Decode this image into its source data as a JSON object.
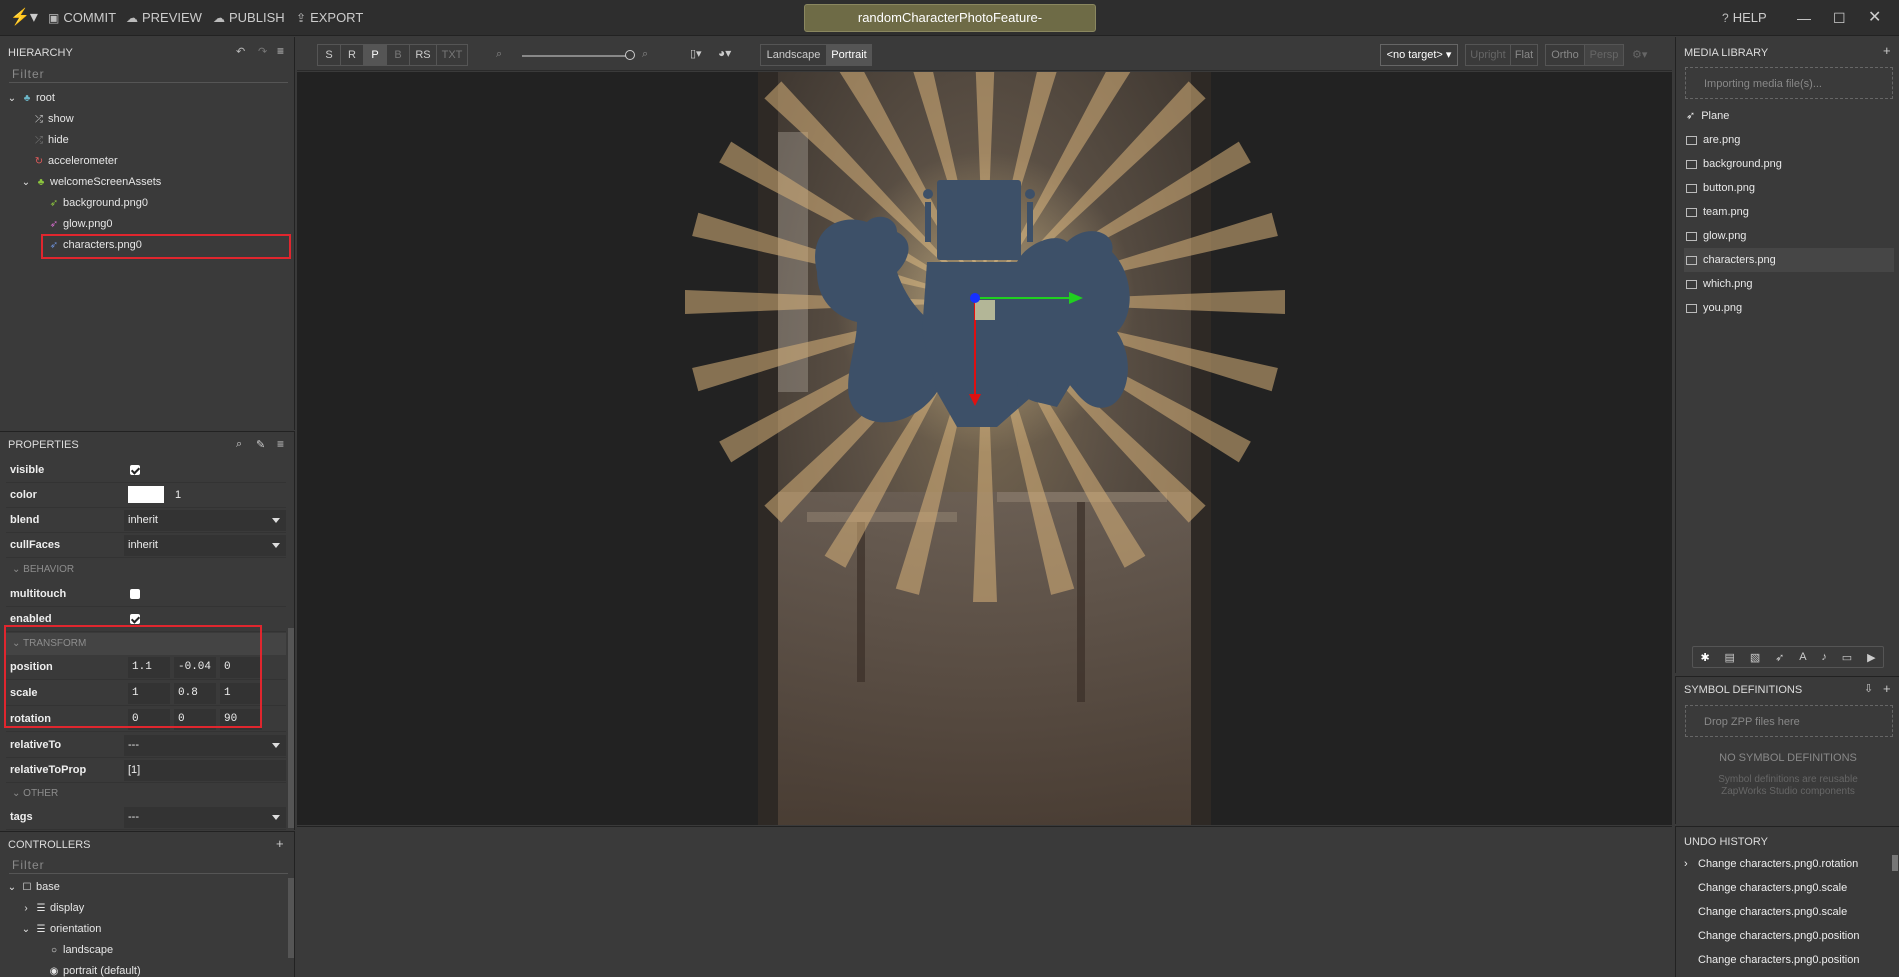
{
  "topbar": {
    "commit": "COMMIT",
    "preview": "PREVIEW",
    "publish": "PUBLISH",
    "export": "EXPORT",
    "project_title": "randomCharacterPhotoFeature-",
    "help": "HELP"
  },
  "hierarchy": {
    "title": "HIERARCHY",
    "filter_placeholder": "Filter",
    "items": [
      {
        "label": "root"
      },
      {
        "label": "show"
      },
      {
        "label": "hide"
      },
      {
        "label": "accelerometer"
      },
      {
        "label": "welcomeScreenAssets"
      },
      {
        "label": "background.png0"
      },
      {
        "label": "glow.png0"
      },
      {
        "label": "characters.png0"
      }
    ]
  },
  "properties": {
    "title": "PROPERTIES",
    "visible_label": "visible",
    "color_label": "color",
    "color_value": "1",
    "blend_label": "blend",
    "blend_value": "inherit",
    "cullfaces_label": "cullFaces",
    "cullfaces_value": "inherit",
    "behavior_section": "BEHAVIOR",
    "multitouch_label": "multitouch",
    "enabled_label": "enabled",
    "transform_section": "TRANSFORM",
    "position_label": "position",
    "position_values": [
      "1.1",
      "-0.04",
      "0"
    ],
    "scale_label": "scale",
    "scale_values": [
      "1",
      "0.8",
      "1"
    ],
    "rotation_label": "rotation",
    "rotation_values": [
      "0",
      "0",
      "90"
    ],
    "relativeto_label": "relativeTo",
    "relativeto_value": "---",
    "relativetoprop_label": "relativeToProp",
    "relativetoprop_value": "[1]",
    "other_section": "OTHER",
    "tags_label": "tags",
    "tags_value": "---"
  },
  "controllers": {
    "title": "CONTROLLERS",
    "filter_placeholder": "Filter",
    "items": [
      {
        "label": "base"
      },
      {
        "label": "display"
      },
      {
        "label": "orientation"
      },
      {
        "label": "landscape"
      },
      {
        "label": "portrait (default)"
      }
    ]
  },
  "viewport_toolbar": {
    "s": "S",
    "r": "R",
    "p": "P",
    "b": "B",
    "rs": "RS",
    "txt": "TXT",
    "landscape": "Landscape",
    "portrait": "Portrait",
    "target": "<no target>",
    "upright": "Upright",
    "flat": "Flat",
    "ortho": "Ortho",
    "persp": "Persp"
  },
  "media_library": {
    "title": "MEDIA LIBRARY",
    "importing_text": "Importing media file(s)...",
    "items": [
      {
        "label": "Plane"
      },
      {
        "label": "are.png"
      },
      {
        "label": "background.png"
      },
      {
        "label": "button.png"
      },
      {
        "label": "team.png"
      },
      {
        "label": "glow.png"
      },
      {
        "label": "characters.png"
      },
      {
        "label": "which.png"
      },
      {
        "label": "you.png"
      }
    ]
  },
  "symbol_definitions": {
    "title": "SYMBOL DEFINITIONS",
    "drop_text": "Drop ZPP files here",
    "none_text": "NO SYMBOL DEFINITIONS",
    "desc_line1": "Symbol definitions are reusable",
    "desc_line2": "ZapWorks Studio components"
  },
  "undo_history": {
    "title": "UNDO HISTORY",
    "items": [
      {
        "label": "Change characters.png0.rotation"
      },
      {
        "label": "Change characters.png0.scale"
      },
      {
        "label": "Change characters.png0.scale"
      },
      {
        "label": "Change characters.png0.position"
      },
      {
        "label": "Change characters.png0.position"
      }
    ]
  },
  "colors": {
    "accent_red": "#e0262e",
    "title_bar": "#6e6b46",
    "silhouette": "#3d5068"
  }
}
